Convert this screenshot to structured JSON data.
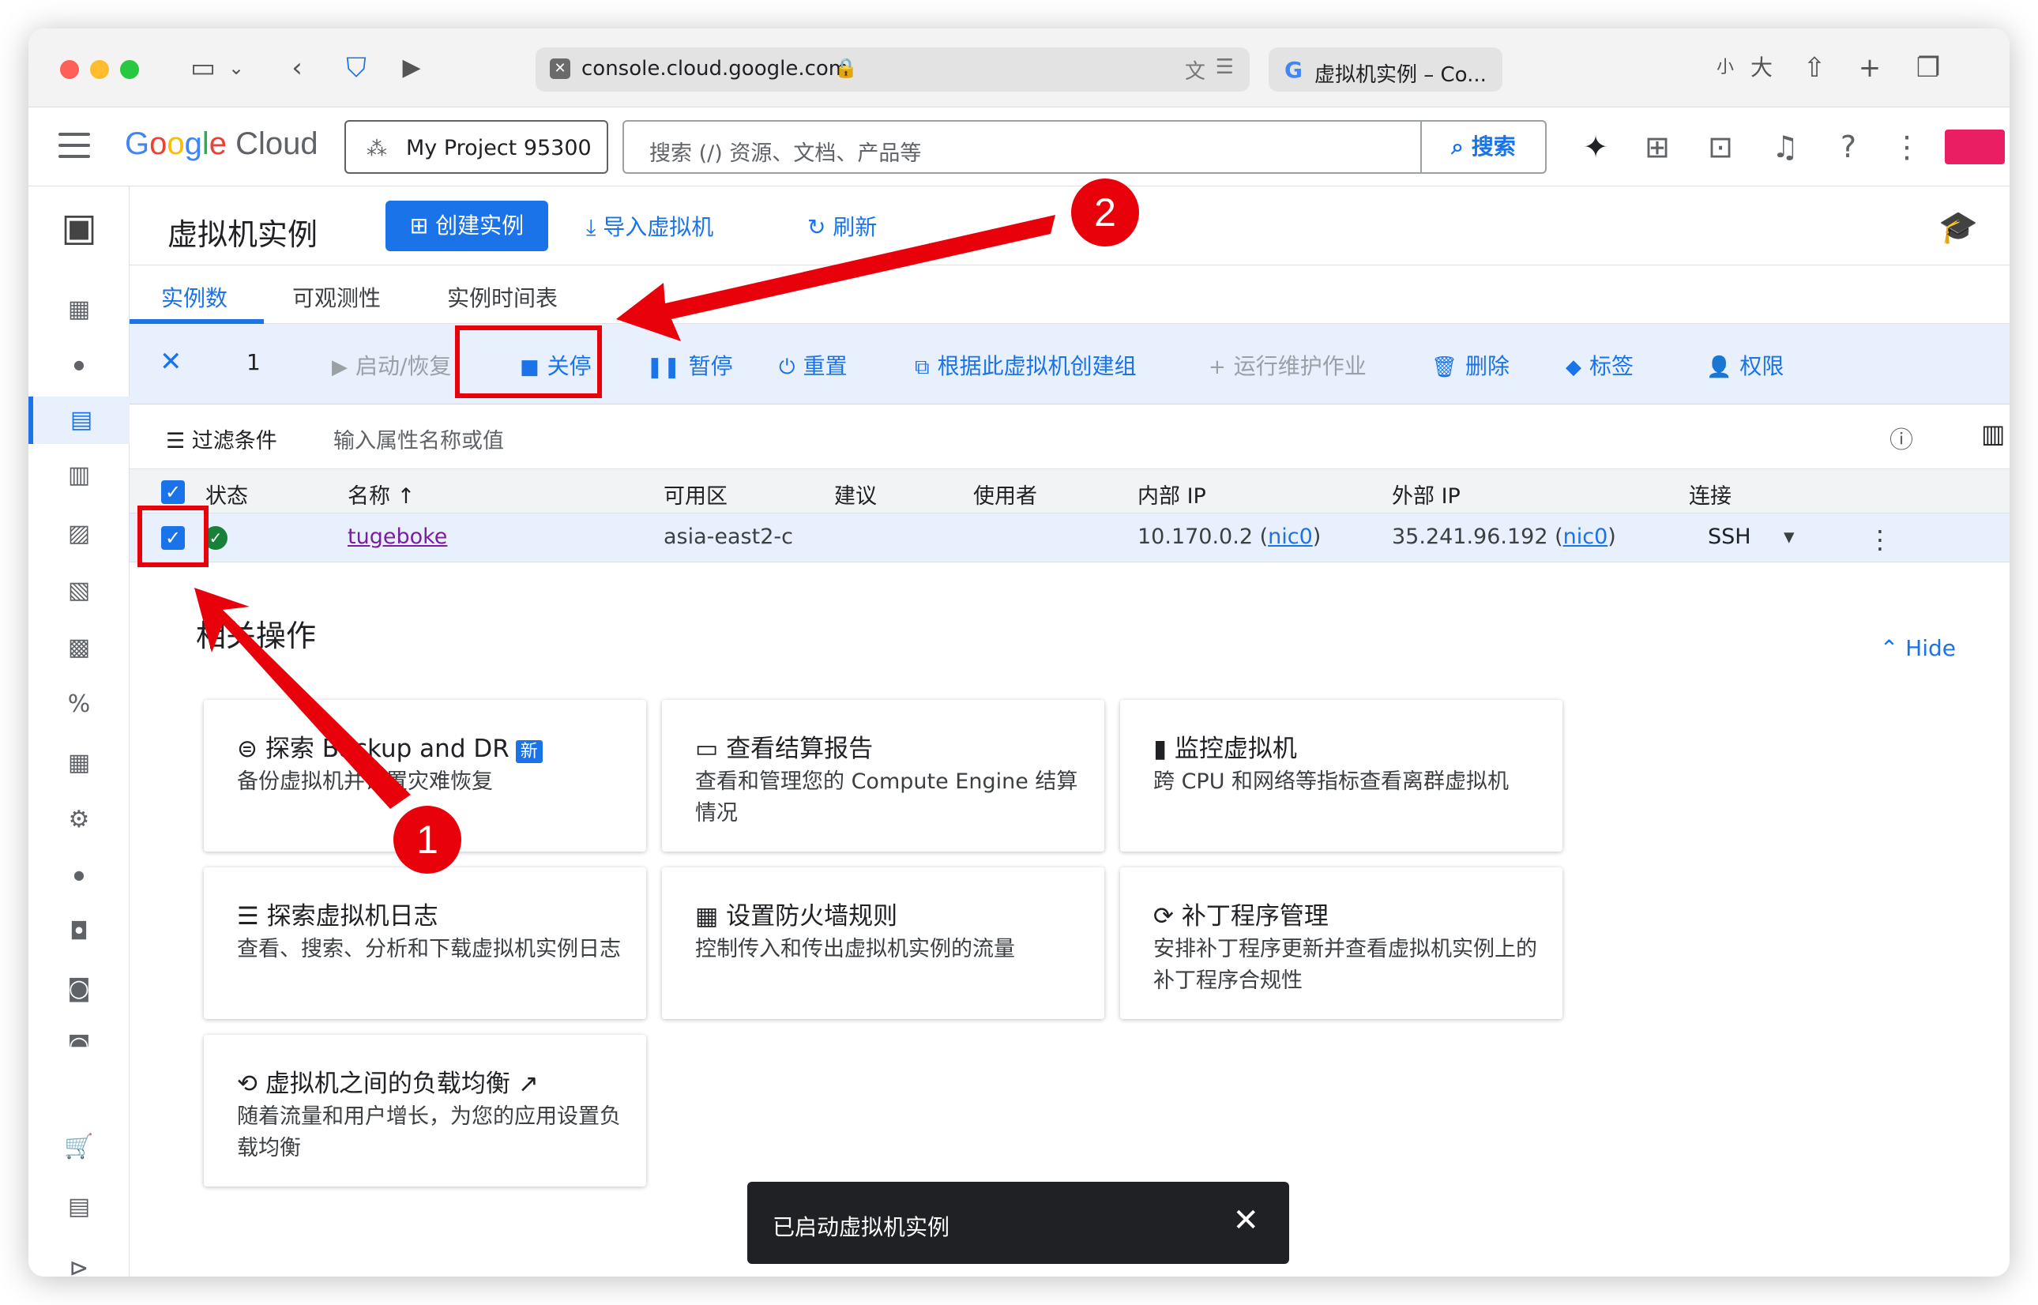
{
  "browser": {
    "url": "console.cloud.google.com",
    "tab_title": "虚拟机实例 – Co...",
    "tab_icon": "G",
    "text_small": "小",
    "text_large": "大"
  },
  "header": {
    "project": "My Project 95300",
    "search_placeholder": "搜索 (/) 资源、文档、产品等",
    "search_button": "搜索"
  },
  "page": {
    "title": "虚拟机实例",
    "create_button": "创建实例",
    "import_button": "导入虚拟机",
    "refresh_button": "刷新"
  },
  "tabs": [
    "实例数",
    "可观测性",
    "实例时间表"
  ],
  "actions": {
    "selected_count": "1",
    "start": "启动/恢复",
    "stop": "关停",
    "pause": "暂停",
    "reset": "重置",
    "create_group": "根据此虚拟机创建组",
    "ops": "运行维护作业",
    "delete": "删除",
    "label": "标签",
    "permissions": "权限"
  },
  "filter": {
    "label": "过滤条件",
    "placeholder": "输入属性名称或值"
  },
  "table": {
    "headers": {
      "status": "状态",
      "name": "名称",
      "zone": "可用区",
      "suggest": "建议",
      "user": "使用者",
      "internal_ip": "内部 IP",
      "external_ip": "外部 IP",
      "connect": "连接"
    },
    "row": {
      "name": "tugeboke",
      "zone": "asia-east2-c",
      "internal_ip": "10.170.0.2 (",
      "nic": "nic0",
      "close_paren": ")",
      "external_ip": "35.241.96.192 (",
      "connect": "SSH"
    }
  },
  "related": {
    "title": "相关操作",
    "hide": "Hide",
    "cards": [
      {
        "title": "探索 Backup and DR",
        "badge": "新",
        "desc": "备份虚拟机并设置灾难恢复"
      },
      {
        "title": "查看结算报告",
        "desc": "查看和管理您的 Compute Engine 结算情况"
      },
      {
        "title": "监控虚拟机",
        "desc": "跨 CPU 和网络等指标查看离群虚拟机"
      },
      {
        "title": "探索虚拟机日志",
        "desc": "查看、搜索、分析和下载虚拟机实例日志"
      },
      {
        "title": "设置防火墙规则",
        "desc": "控制传入和传出虚拟机实例的流量"
      },
      {
        "title": "补丁程序管理",
        "desc": "安排补丁程序更新并查看虚拟机实例上的补丁程序合规性"
      },
      {
        "title": "虚拟机之间的负载均衡",
        "desc": "随着流量和用户增长，为您的应用设置负载均衡"
      }
    ]
  },
  "toast": {
    "message": "已启动虚拟机实例"
  },
  "annotations": {
    "step1": "1",
    "step2": "2"
  },
  "colors": {
    "accent": "#1a73e8",
    "annotation_red": "#e8000b",
    "status_green": "#188038"
  }
}
